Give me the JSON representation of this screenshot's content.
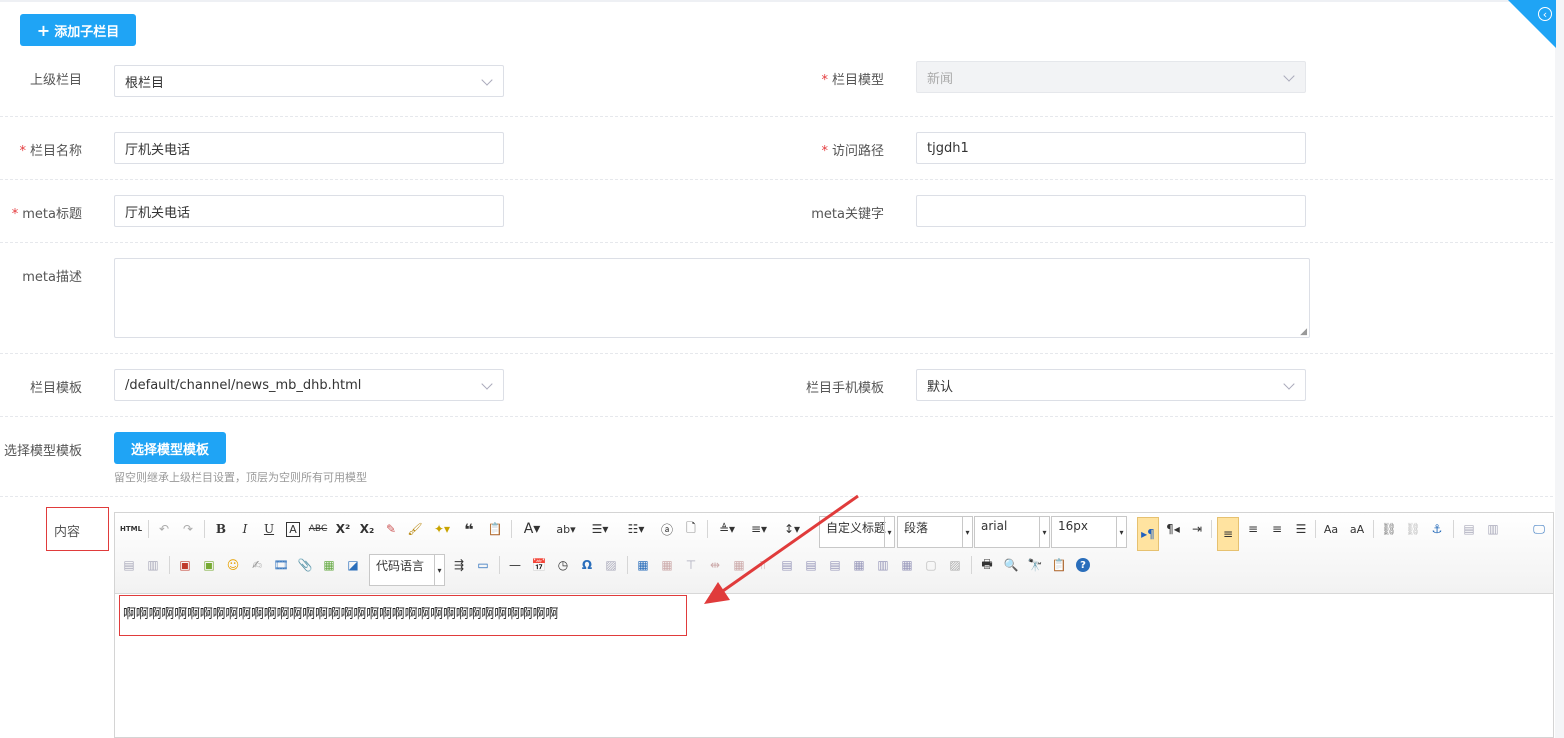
{
  "add_button": {
    "icon": "plus-icon",
    "label": "添加子栏目"
  },
  "form": {
    "parent": {
      "label": "上级栏目",
      "value": "根栏目"
    },
    "model": {
      "label": "栏目模型",
      "value": "新闻"
    },
    "name": {
      "label": "栏目名称",
      "value": "厅机关电话"
    },
    "path": {
      "label": "访问路径",
      "value": "tjgdh1"
    },
    "meta_title": {
      "label": "meta标题",
      "value": "厅机关电话"
    },
    "meta_keywords": {
      "label": "meta关键字",
      "value": ""
    },
    "meta_desc": {
      "label": "meta描述",
      "value": ""
    },
    "template": {
      "label": "栏目模板",
      "value": "/default/channel/news_mb_dhb.html"
    },
    "mobile_template": {
      "label": "栏目手机模板",
      "value": "默认"
    },
    "model_template": {
      "label": "选择模型模板",
      "button": "选择模型模板",
      "hint": "留空则继承上级栏目设置，顶层为空则所有可用模型"
    },
    "content": {
      "label": "内容"
    }
  },
  "editor": {
    "html_label": "HTML",
    "custom_title": "自定义标题",
    "paragraph": "段落",
    "font": "arial",
    "size": "16px",
    "code_lang": "代码语言",
    "text": "啊啊啊啊啊啊啊啊啊啊啊啊啊啊啊啊啊啊啊啊啊啊啊啊啊啊啊啊啊啊啊啊啊啊"
  },
  "colors": {
    "accent": "#1fa4f5",
    "required": "#e4393c",
    "annotation": "#e03b3b"
  }
}
